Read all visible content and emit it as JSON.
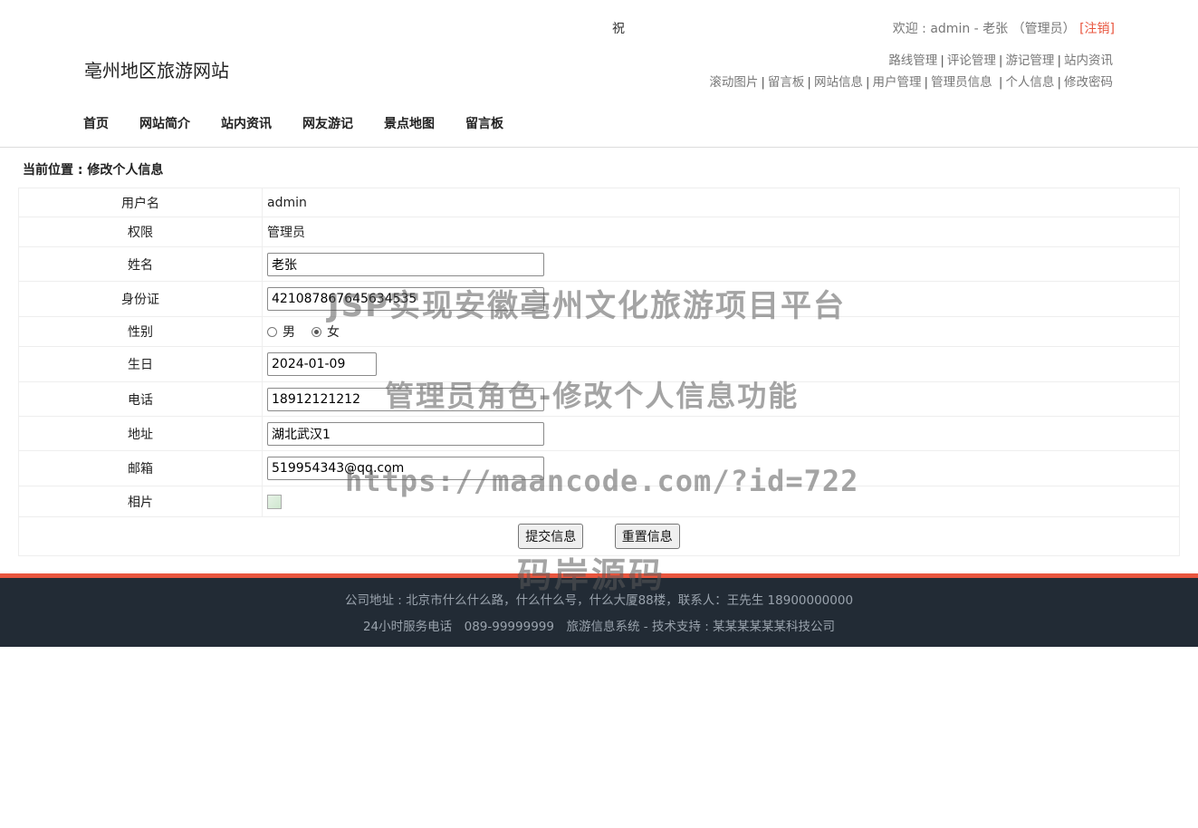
{
  "header": {
    "marquee": "祝",
    "welcome_prefix": "欢迎 : admin - 老张 （管理员）",
    "logout": "[注销]",
    "site_title": "亳州地区旅游网站",
    "admin_links_row1": [
      "路线管理",
      "评论管理",
      "游记管理",
      "站内资讯"
    ],
    "admin_links_row2": [
      "滚动图片",
      "留言板",
      "网站信息",
      "用户管理",
      "管理员信息",
      "个人信息",
      "修改密码"
    ]
  },
  "nav": [
    "首页",
    "网站简介",
    "站内资讯",
    "网友游记",
    "景点地图",
    "留言板"
  ],
  "breadcrumb": "当前位置 : 修改个人信息",
  "form": {
    "username_label": "用户名",
    "username_value": "admin",
    "role_label": "权限",
    "role_value": "管理员",
    "name_label": "姓名",
    "name_value": "老张",
    "id_label": "身份证",
    "id_value": "421087867645634535",
    "gender_label": "性别",
    "gender_male": "男",
    "gender_female": "女",
    "gender_selected": "女",
    "birthday_label": "生日",
    "birthday_value": "2024-01-09",
    "phone_label": "电话",
    "phone_value": "18912121212",
    "address_label": "地址",
    "address_value": "湖北武汉1",
    "email_label": "邮箱",
    "email_value": "519954343@qq.com",
    "photo_label": "相片",
    "submit_label": "提交信息",
    "reset_label": "重置信息"
  },
  "footer": {
    "line1": "公司地址 : 北京市什么什么路，什么什么号，什么大厦88楼，联系人：王先生 18900000000",
    "line2": "24小时服务电话　089-99999999　旅游信息系统 - 技术支持 : 某某某某某某科技公司"
  },
  "watermarks": [
    "JSP实现安徽亳州文化旅游项目平台",
    "管理员角色-修改个人信息功能",
    "https://maancode.com/?id=722",
    "码岸源码"
  ],
  "colors": {
    "accent": "#e8553e",
    "footer_bg": "#222b35"
  }
}
